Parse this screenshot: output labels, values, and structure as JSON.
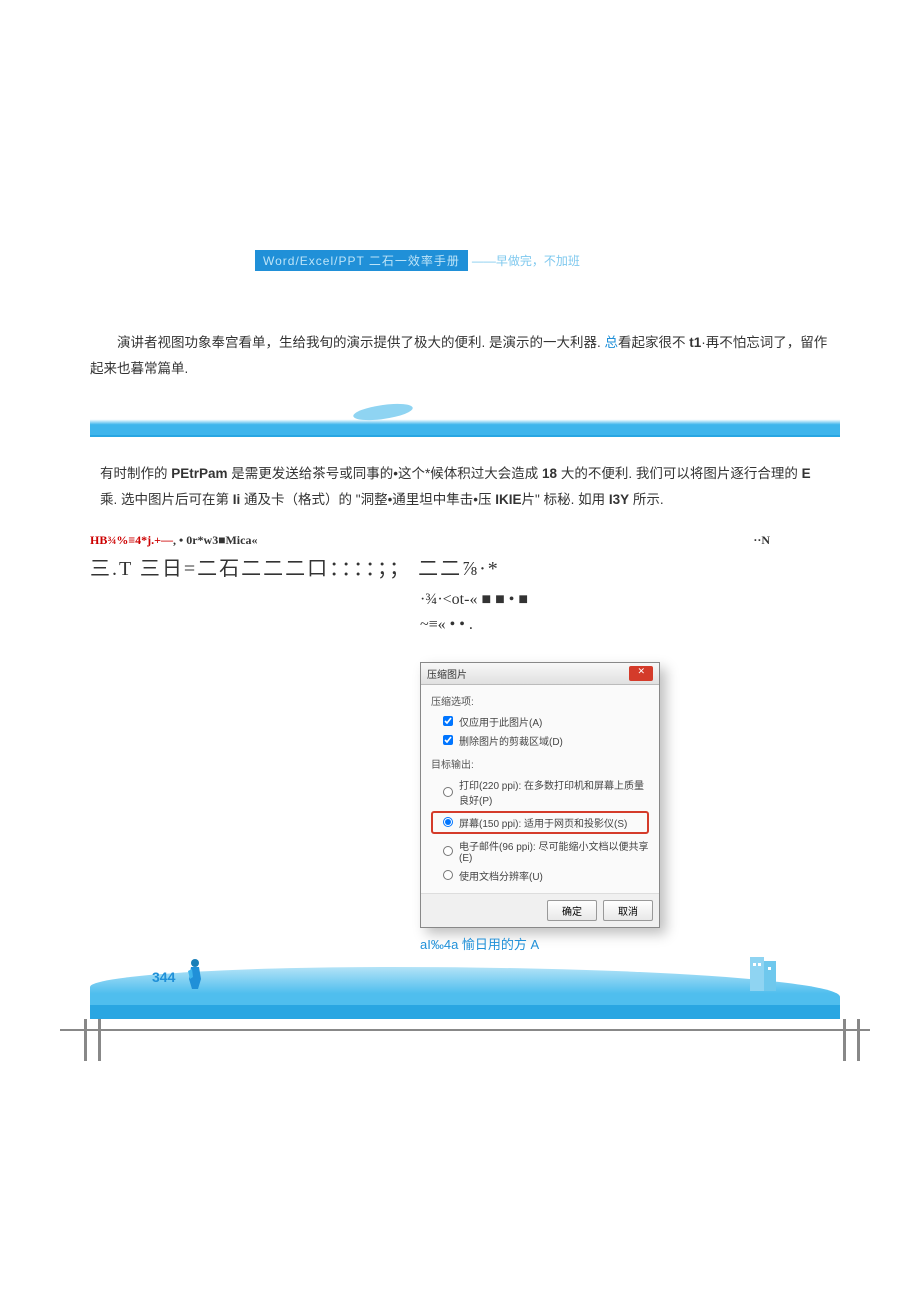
{
  "header": {
    "blue_text": "Word/Excel/PPT 二石一效率手册",
    "tail_text": "——早做完，不加班"
  },
  "paragraph1": {
    "text_a": "演讲者视图功象奉宫看单，生给我旬的演示提供了极大的便利. 是演示的一大利器. ",
    "link": "总",
    "text_b": "看起家很不",
    "bold1": "t1",
    "text_c": "·再不怕忘词了，留作起来也暮常篇单."
  },
  "paragraph2": {
    "text_a": "有时制作的 ",
    "bold1": "PEtrPam",
    "text_b": " 是需更发送给茶号或同事的•这个*候体积过大会造成 ",
    "bold2": "18",
    "text_c": " 大的不便利. 我们可以将图片逐行合理的 ",
    "bold3": "E",
    "text_d": " 乘. 选中图片后可在第 ",
    "bold4": "Ii",
    "text_e": " 通及卡（格式）的 \"洞整•通里坦中隼击•压 ",
    "bold5": "IKIE",
    "text_f": "片\" 标秘. 如用 ",
    "bold6": "I3Y",
    "text_g": " 所示."
  },
  "garbled": {
    "line1_red": "HB¾%≡4*j.+—",
    "line1_rest": ",  •  0r*w3■Mica«",
    "line1_right": "··N",
    "line2": "三.T 三日=二石二二二口：：：：；； 二二⅞·*",
    "right1": "·¾·<ot-« ■ ■ • ■",
    "right2": "~≡« • • ."
  },
  "dialog": {
    "title": "压缩图片",
    "group1_label": "压缩选项:",
    "check1": "仅应用于此图片(A)",
    "check2": "删除图片的剪裁区域(D)",
    "group2_label": "目标输出:",
    "radio1": "打印(220 ppi): 在多数打印机和屏幕上质量良好(P)",
    "radio2_highlighted": "屏幕(150 ppi): 适用于网页和投影仪(S)",
    "radio3": "电子邮件(96 ppi): 尽可能缩小文档以便共享(E)",
    "radio4": "使用文档分辨率(U)",
    "btn_ok": "确定",
    "btn_cancel": "取消",
    "caption": "aI‰4a 愉日用的方 A"
  },
  "footer": {
    "page_number": "344"
  }
}
